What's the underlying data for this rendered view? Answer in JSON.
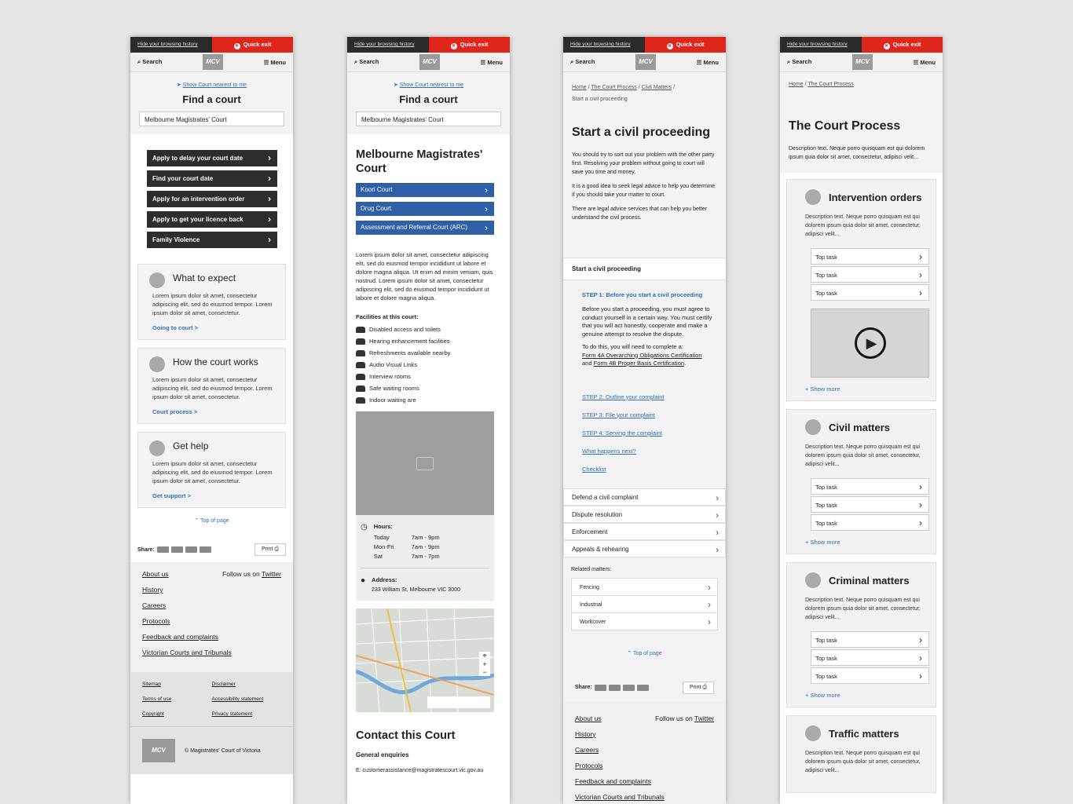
{
  "common": {
    "hide": "Hide your browsing history",
    "quick": "Quick exit",
    "search": "Search",
    "menu": "Menu",
    "logo": "MCV",
    "top": "Top of page",
    "share": "Share:",
    "print": "Print",
    "about": "About us",
    "follow": "Follow us on",
    "twitter": "Twitter",
    "footer_links": [
      "History",
      "Careers",
      "Protocols",
      "Feedback and complaints",
      "Victorian Courts and Tribunals"
    ],
    "legal": [
      "Sitemap",
      "Disclaimer",
      "Terms of use",
      "Accessibility statement",
      "Copyright",
      "Privacy statement"
    ],
    "copyright": "© Magistrates' Court of Victoria"
  },
  "p1": {
    "nearest": "Show Court nearest to me",
    "title": "Find a court",
    "input": "Melbourne Magistrates' Court",
    "buttons": [
      "Apply to delay your court date",
      "Find your court date",
      "Apply for an intervention order",
      "Apply to get your licence back",
      "Family Violence"
    ],
    "cards": [
      {
        "t": "What to expect",
        "d": "Lorem ipsum dolor sit amet, consectetur adipiscing elit, sed do eiusmod tempor. Lorem ipsum dolor sit amet, consectetur.",
        "l": "Going to court  >"
      },
      {
        "t": "How the court works",
        "d": "Lorem ipsum dolor sit amet, consectetur adipiscing elit, sed do eiusmod tempor. Lorem ipsum dolor sit amet, consectetur.",
        "l": "Court process  >"
      },
      {
        "t": "Get help",
        "d": "Lorem ipsum dolor sit amet, consectetur adipiscing elit, sed do eiusmod tempor. Lorem ipsum dolor sit amet, consectetur.",
        "l": "Get support >"
      }
    ]
  },
  "p2": {
    "nearest": "Show Court nearest to me",
    "title": "Find a court",
    "input": "Melbourne Magistrates' Court",
    "court": "Melbourne Magistrates' Court",
    "blue": [
      "Koori Court",
      "Drug Court",
      "Assessment and Referral Court (ARC)"
    ],
    "desc": "Lorem ipsum dolor sit amet, consectetur adipiscing elit, sed do eiusmod tempor incididunt ut labore et dolore magna aliqua. Ut enim ad minim veniam, quis nostrud. Lorem ipsum dolor sit amet, consectetur adipiscing elit, sed do eiusmod tempor incididunt ut labore et dolore magna aliqua.",
    "fac_title": "Facilities at this court:",
    "facilities": [
      "Disabled access and toilets",
      "Hearing enhancement facilities",
      "Refreshments available nearby.",
      "Audio Visual Links",
      "Interview rooms",
      "Safe waiting rooms",
      "Indoor waiting are"
    ],
    "hours_title": "Hours:",
    "hours": [
      [
        "Today",
        "7am - 9pm"
      ],
      [
        "Mon-Fri",
        "7am - 9pm"
      ],
      [
        "Sat",
        "7am - 7pm"
      ]
    ],
    "addr_title": "Address:",
    "addr": "233 William St, Melbourne VIC 3000",
    "contact": "Contact this Court",
    "enq": "General enquiries",
    "email": "E: customerassistance@magistratescourt.vic.gov.au"
  },
  "p3": {
    "crumb1": "Home",
    "crumb2": "The Court Process",
    "crumb3": "Civil Matters",
    "crumb4": "Start a civil proceeding",
    "title": "Start a civil proceeding",
    "paras": [
      "You should try to sort out your problem with the other party first. Resolving your problem without going to court will save you time and money.",
      "It is a good idea to seek legal advice to help you determine if you should take your matter to court.",
      "There are legal advice services that can help you better understand the civil process."
    ],
    "section": "Start a civil proceeding",
    "step1": "STEP 1: Before you start a civil proceeding",
    "step1_text": "Before you start a proceeding, you must agree to conduct yourself in a certain way. You must certify that you will act honestly, cooperate and make a genuine attempt to resolve the dispute.",
    "step1_need": "To do this, you will need to complete a:",
    "form4a": "Form 4A Overarching Obligations Certification",
    "and": "and",
    "form4b": "Form 4B Proper Basis Certification",
    "steps": [
      "STEP 2: Outline your complaint",
      "STEP 3: File your complaint",
      "STEP 4: Serving the complaint",
      "What happens next?",
      "Checklist"
    ],
    "rows": [
      "Defend a civil complaint",
      "Dispute resolution",
      "Enforcement",
      "Appeals & rehearing"
    ],
    "related": "Related matters:",
    "related_items": [
      "Fencing",
      "Industrial",
      "Workcover"
    ]
  },
  "p4": {
    "crumb1": "Home",
    "crumb2": "The Court Process",
    "title": "The Court Process",
    "desc": "Description text. Neque porro quisquam est qui dolorem ipsum quia dolor sit amet, consectetur, adipisci velit...",
    "cards": [
      {
        "t": "Intervention orders",
        "video": true
      },
      {
        "t": "Civil matters"
      },
      {
        "t": "Criminal matters"
      },
      {
        "t": "Traffic matters"
      }
    ],
    "card_desc": "Description text. Neque porro quisquam est qui dolorem ipsum quia dolor sit amet, consectetur, adipisci velit...",
    "task": "Top task",
    "more": "+ Show more"
  }
}
